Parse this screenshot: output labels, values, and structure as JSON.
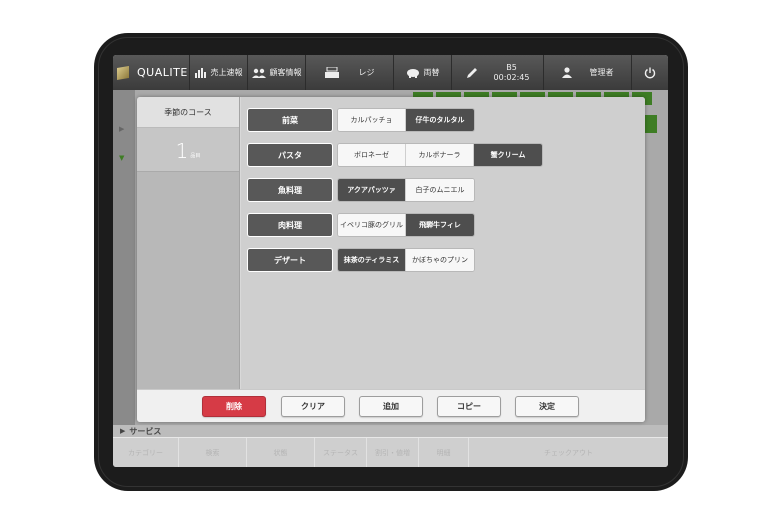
{
  "topbar": {
    "logo_text": "QUALITE",
    "logo_sub": "",
    "items": [
      {
        "label": "売上速報",
        "icon": "bar-chart-icon"
      },
      {
        "label": "顧客情報",
        "icon": "users-icon"
      },
      {
        "label": "レジ",
        "icon": "register-icon"
      },
      {
        "label": "両替",
        "icon": "piggy-bank-icon"
      },
      {
        "label": "",
        "icon": "pen-icon"
      },
      {
        "label": "管理者",
        "icon": "person-icon"
      }
    ],
    "table": "B5",
    "time": "00:02:45"
  },
  "background": {
    "section_label": "サービス",
    "bottom_tabs": [
      "カテゴリー",
      "検索",
      "状態",
      "ステータス",
      "割引・値増",
      "明細",
      "チェックアウト"
    ]
  },
  "modal": {
    "course_title": "季節のコース",
    "course_count": "1",
    "course_count_unit": "品目",
    "rows": [
      {
        "category": "前菜",
        "options": [
          "カルパッチョ",
          "仔牛のタルタル"
        ],
        "selected": 1
      },
      {
        "category": "パスタ",
        "options": [
          "ボロネーゼ",
          "カルボナーラ",
          "蟹クリーム"
        ],
        "selected": 2
      },
      {
        "category": "魚料理",
        "options": [
          "アクアパッツァ",
          "白子のムニエル"
        ],
        "selected": 0
      },
      {
        "category": "肉料理",
        "options": [
          "イベリコ豚のグリル",
          "飛騨牛フィレ"
        ],
        "selected": 1
      },
      {
        "category": "デザート",
        "options": [
          "抹茶のティラミス",
          "かぼちゃのプリン"
        ],
        "selected": 0
      }
    ],
    "buttons": {
      "delete": "削除",
      "clear": "クリア",
      "add": "追加",
      "copy": "コピー",
      "confirm": "決定"
    }
  },
  "colors": {
    "accent_green": "#3e7d24",
    "danger": "#d63b46",
    "selected": "#4e4e4e"
  }
}
